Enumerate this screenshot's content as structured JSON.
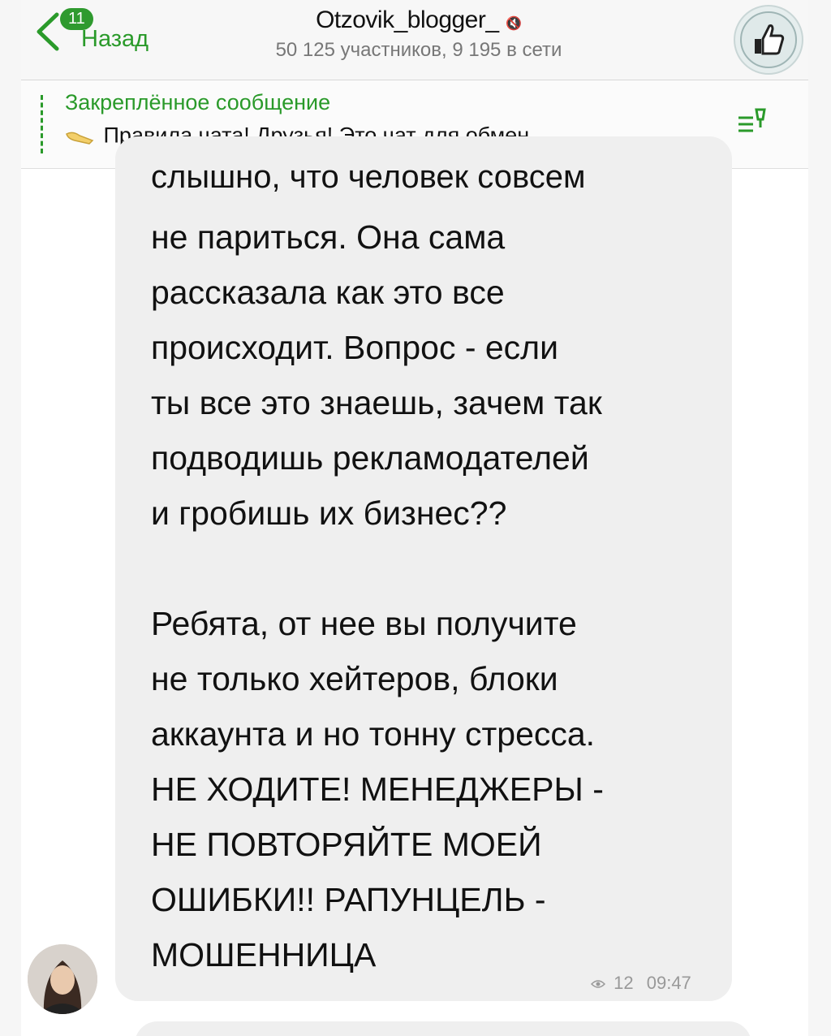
{
  "header": {
    "back_badge": "11",
    "back_label": "Назад",
    "title": "Otzovik_blogger_",
    "mute_icon": "mute-icon",
    "subtitle": "50 125 участников, 9 195 в сети",
    "group_avatar_icon": "like-logo-icon"
  },
  "pinned": {
    "title": "Закреплённое сообщение",
    "text": "Правила чата!  Друзья! Это чат для обмен...",
    "emoji": "pointing-hand-icon",
    "list_icon": "pinned-list-icon"
  },
  "message": {
    "cut_line": "слышно, что человек совсем",
    "body": "не париться. Она сама\nрассказала как это все\nпроисходит. Вопрос - если\nты все это знаешь, зачем так\nподводишь рекламодателей\nи гробишь их бизнес??\n\nРебята, от нее вы получите\nне только хейтеров, блоки\nаккаунта и но тонну стресса.\nНЕ ХОДИТЕ! МЕНЕДЖЕРЫ -\nНЕ ПОВТОРЯЙТЕ МОЕЙ\nОШИБКИ!! РАПУНЦЕЛЬ -\nМОШЕННИЦА",
    "views": "12",
    "time": "09:47",
    "views_icon": "views-icon"
  },
  "colors": {
    "accent": "#2a9a2a",
    "bubble": "#efefef",
    "header_bg": "#f7f7f7"
  }
}
